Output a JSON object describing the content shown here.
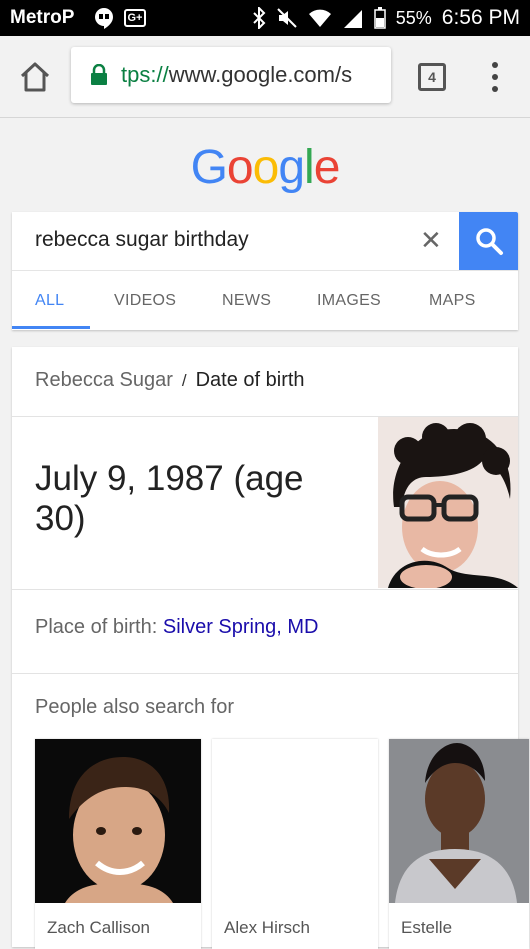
{
  "status": {
    "carrier": "MetroP",
    "battery": "55%",
    "time": "6:56 PM"
  },
  "browser": {
    "url_scheme": "tps://",
    "url_host": "www.google.com/s",
    "tab_count": "4"
  },
  "logo": {
    "letters": [
      "G",
      "o",
      "o",
      "g",
      "l",
      "e"
    ],
    "colors": [
      "#4285f4",
      "#ea4335",
      "#fbbc05",
      "#4285f4",
      "#34a853",
      "#ea4335"
    ]
  },
  "search": {
    "query": "rebecca sugar birthday",
    "clear_glyph": "✕"
  },
  "tabs": [
    {
      "label": "ALL"
    },
    {
      "label": "VIDEOS"
    },
    {
      "label": "NEWS"
    },
    {
      "label": "IMAGES"
    },
    {
      "label": "MAPS"
    }
  ],
  "knowledge": {
    "entity": "Rebecca Sugar",
    "separator": "/",
    "attribute": "Date of birth",
    "answer": "July 9, 1987 (age 30)",
    "place_label": "Place of birth:",
    "place_value": "Silver Spring, MD",
    "pasf_title": "People also search for",
    "people": [
      {
        "name": "Zach Callison"
      },
      {
        "name": "Alex Hirsch"
      },
      {
        "name": "Estelle"
      }
    ]
  },
  "colors": {
    "accent": "#4285f4",
    "link": "#1a0dab",
    "secure": "#0b8043"
  }
}
